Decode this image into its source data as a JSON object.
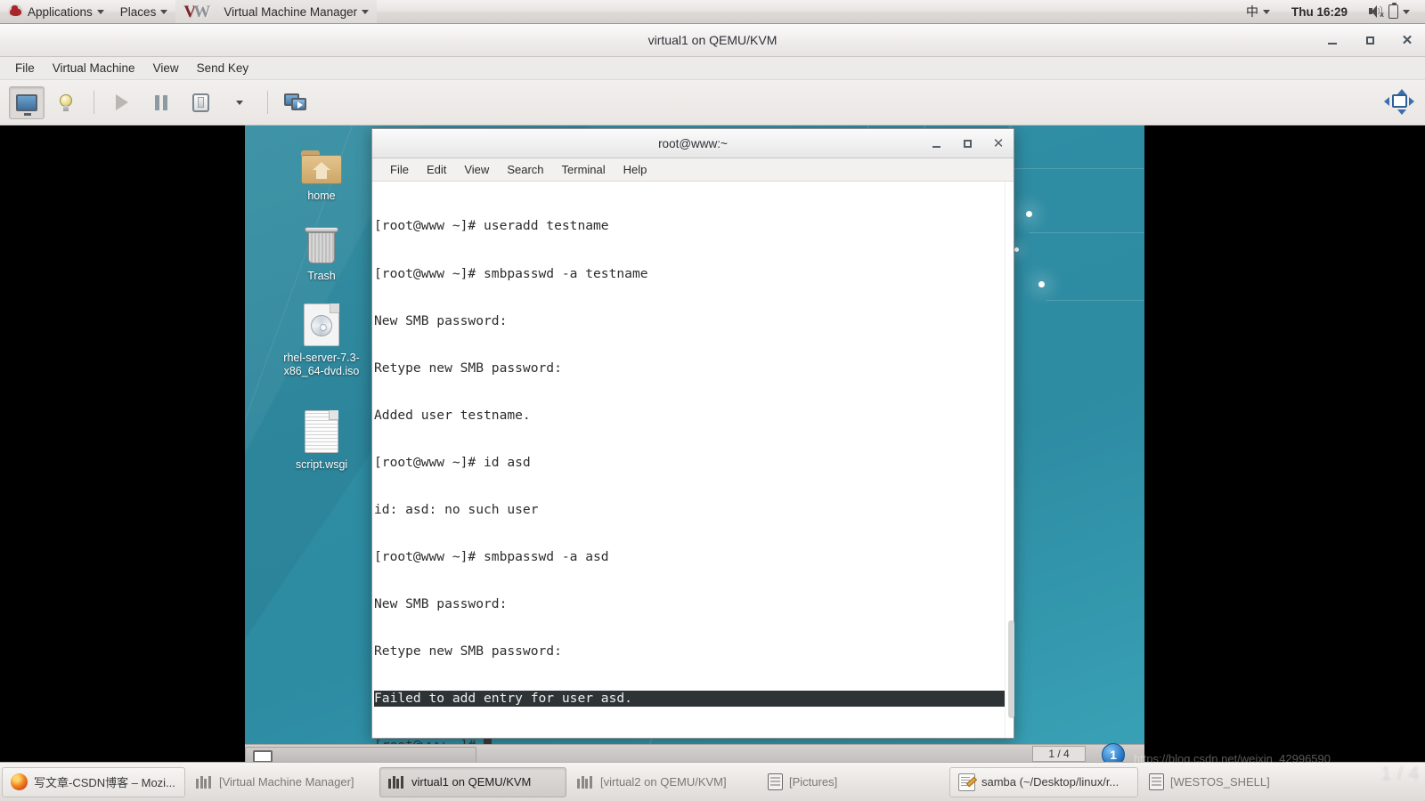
{
  "gnome_panel": {
    "applications_label": "Applications",
    "places_label": "Places",
    "active_app_label": "Virtual Machine Manager",
    "input_method": "中",
    "clock": "Thu 16:29"
  },
  "vmm_window": {
    "title": "virtual1 on QEMU/KVM",
    "menus": [
      "File",
      "Virtual Machine",
      "View",
      "Send Key"
    ],
    "toolbar_icons": [
      "show-console-icon",
      "show-details-icon",
      "run-icon",
      "pause-icon",
      "shutdown-icon",
      "shutdown-dropdown-icon",
      "snapshots-icon",
      "fullscreen-icon"
    ]
  },
  "guest_desktop": {
    "icons": [
      {
        "name": "home",
        "label": "home",
        "glyph": "folder-home-icon"
      },
      {
        "name": "trash",
        "label": "Trash",
        "glyph": "trash-icon"
      },
      {
        "name": "iso",
        "label": "rhel-server-7.3-x86_64-dvd.iso",
        "glyph": "disc-image-icon"
      },
      {
        "name": "wsgi",
        "label": "script.wsgi",
        "glyph": "text-document-icon"
      }
    ],
    "taskbar": {
      "workspace_indicator": "1 / 4",
      "workspace_button": "1"
    }
  },
  "terminal": {
    "title": "root@www:~",
    "menus": [
      "File",
      "Edit",
      "View",
      "Search",
      "Terminal",
      "Help"
    ],
    "lines": [
      {
        "text": "[root@www ~]# useradd testname",
        "highlight": false
      },
      {
        "text": "[root@www ~]# smbpasswd -a testname",
        "highlight": false
      },
      {
        "text": "New SMB password:",
        "highlight": false
      },
      {
        "text": "Retype new SMB password:",
        "highlight": false
      },
      {
        "text": "Added user testname.",
        "highlight": false
      },
      {
        "text": "[root@www ~]# id asd",
        "highlight": false
      },
      {
        "text": "id: asd: no such user",
        "highlight": false
      },
      {
        "text": "[root@www ~]# smbpasswd -a asd",
        "highlight": false
      },
      {
        "text": "New SMB password:",
        "highlight": false
      },
      {
        "text": "Retype new SMB password:",
        "highlight": false
      },
      {
        "text": "Failed to add entry for user asd.",
        "highlight": true
      }
    ],
    "prompt": "[root@www ~]# "
  },
  "host_taskbar": {
    "tasks": [
      {
        "label": "写文章-CSDN博客 – Mozi...",
        "icon": "firefox-icon",
        "state": "normal"
      },
      {
        "label": "[Virtual Machine Manager]",
        "icon": "vmm-icon",
        "state": "inactive"
      },
      {
        "label": "virtual1 on QEMU/KVM",
        "icon": "vmm-icon",
        "state": "active"
      },
      {
        "label": "[virtual2 on QEMU/KVM]",
        "icon": "vmm-icon",
        "state": "inactive"
      },
      {
        "label": "[Pictures]",
        "icon": "files-icon",
        "state": "inactive"
      },
      {
        "label": "samba (~/Desktop/linux/r...",
        "icon": "gedit-icon",
        "state": "normal"
      },
      {
        "label": "[WESTOS_SHELL]",
        "icon": "files-icon",
        "state": "inactive"
      }
    ]
  },
  "watermark": {
    "url": "https://blog.csdn.net/weixin_42996590",
    "counter": "1 / 4"
  },
  "colors": {
    "desktop_teal": "#2e8ca3",
    "terminal_bg": "#ffffff",
    "terminal_fg": "#2d2d2d",
    "highlight_bg": "#2e3436",
    "highlight_fg": "#eeeeec",
    "panel_bg": "#e7e4e2"
  }
}
